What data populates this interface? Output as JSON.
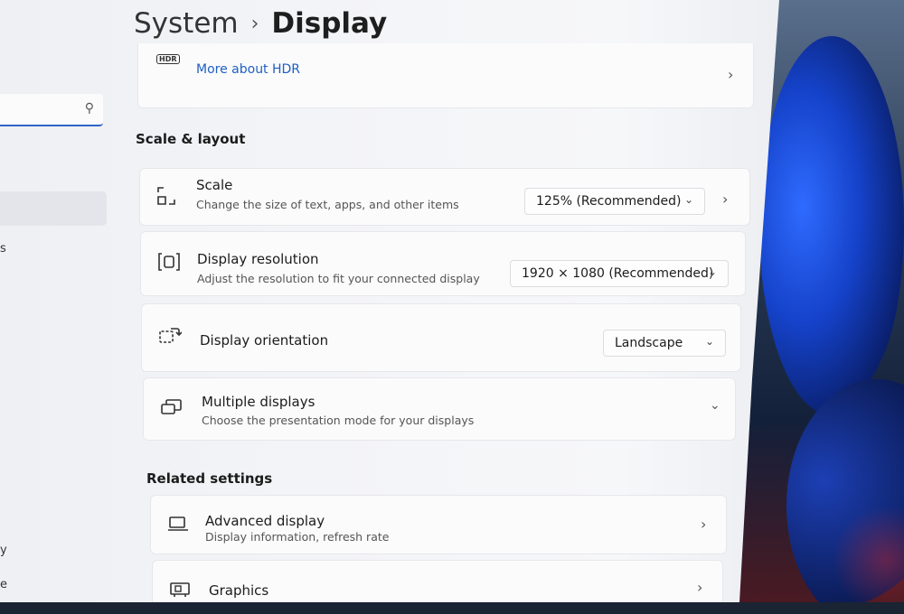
{
  "breadcrumb": {
    "parent": "System",
    "separator": "›",
    "current": "Display"
  },
  "hdr": {
    "badge": "HDR",
    "link": "More about HDR"
  },
  "sidebar": {
    "frag1": "s",
    "frag2": "y",
    "frag3": "e"
  },
  "sections": {
    "scale_layout": "Scale & layout",
    "related": "Related settings"
  },
  "scale": {
    "title": "Scale",
    "desc": "Change the size of text, apps, and other items",
    "value": "125% (Recommended)"
  },
  "resolution": {
    "title": "Display resolution",
    "desc": "Adjust the resolution to fit your connected display",
    "value": "1920 × 1080 (Recommended)"
  },
  "orientation": {
    "title": "Display orientation",
    "value": "Landscape"
  },
  "multiple": {
    "title": "Multiple displays",
    "desc": "Choose the presentation mode for your displays"
  },
  "advanced": {
    "title": "Advanced display",
    "desc": "Display information, refresh rate"
  },
  "graphics": {
    "title": "Graphics"
  },
  "icons": {
    "scale": "scale-icon",
    "resolution": "resolution-icon",
    "orientation": "orientation-icon",
    "multiple": "multiple-displays-icon",
    "advanced": "monitor-icon",
    "graphics": "graphics-icon"
  }
}
